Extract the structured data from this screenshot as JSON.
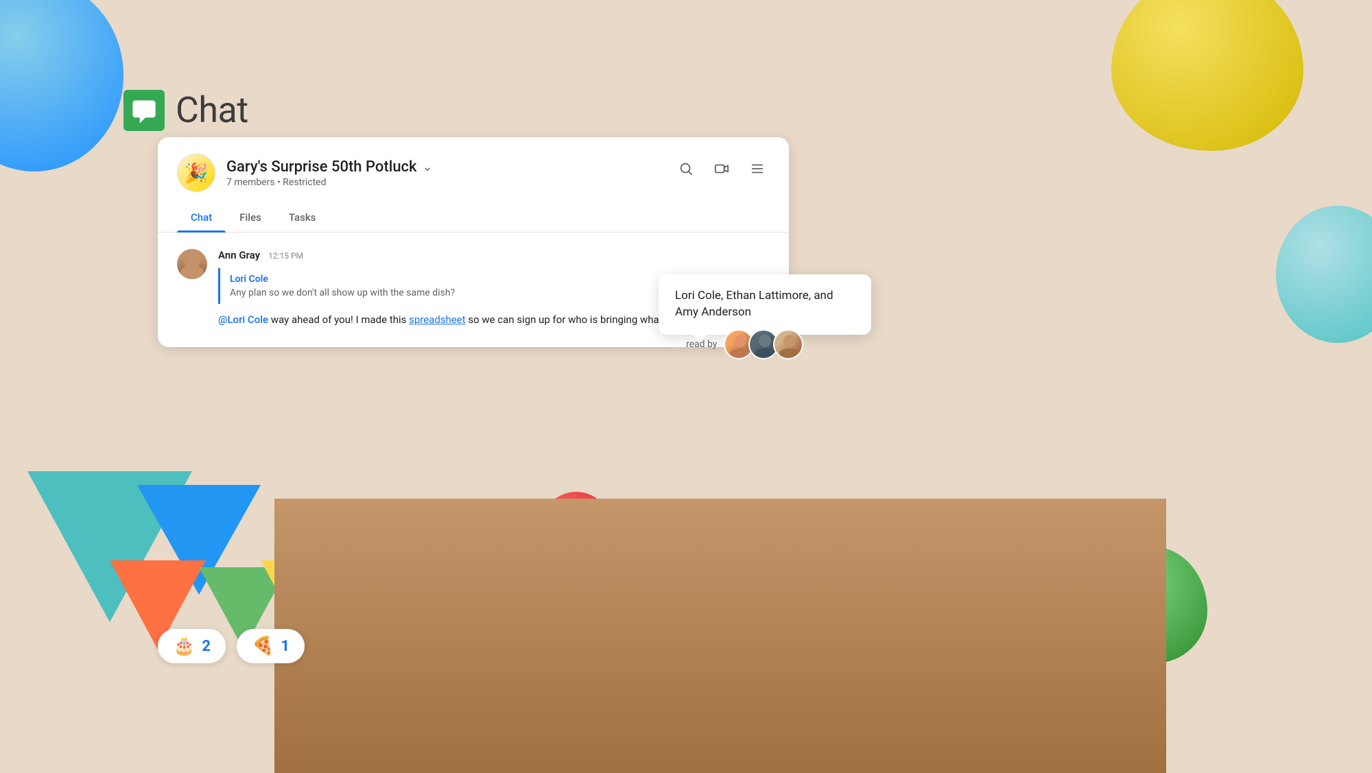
{
  "app": {
    "name": "Chat",
    "logo_color": "#34a853"
  },
  "group": {
    "name": "Gary's Surprise 50th Potluck",
    "member_count": "7 members",
    "privacy": "Restricted",
    "avatar_emoji": "🎉"
  },
  "tabs": [
    {
      "label": "Chat",
      "active": true
    },
    {
      "label": "Files",
      "active": false
    },
    {
      "label": "Tasks",
      "active": false
    }
  ],
  "message": {
    "sender": "Ann Gray",
    "time": "12:15 PM",
    "quoted": {
      "sender": "Lori Cole",
      "text": "Any plan so we don't all show up with the same dish?"
    },
    "mention": "@Lori Cole",
    "body_text": " way ahead of you! I made this ",
    "link_text": "spreadsheet",
    "body_suffix": " so we can sign up for who is bringing what"
  },
  "tooltip": {
    "text": "Lori Cole, Ethan Lattimore, and Amy Anderson"
  },
  "read_by": {
    "label": "read by"
  },
  "reactions": [
    {
      "emoji": "🎂",
      "count": "2"
    },
    {
      "emoji": "🍕",
      "count": "1"
    }
  ],
  "icons": {
    "search": "search-icon",
    "video": "video-icon",
    "menu": "menu-icon",
    "chevron_down": "chevron-down-icon"
  }
}
